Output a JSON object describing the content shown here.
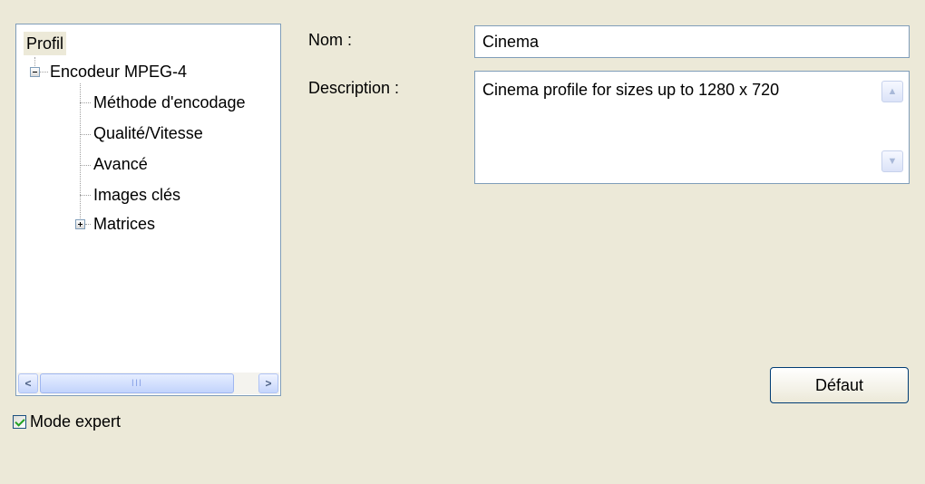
{
  "tree": {
    "root_label": "Profil",
    "nodes": [
      {
        "label": "Encodeur MPEG-4",
        "expander": "minus"
      },
      {
        "label": "Méthode d'encodage"
      },
      {
        "label": "Qualité/Vitesse"
      },
      {
        "label": "Avancé"
      },
      {
        "label": "Images clés"
      },
      {
        "label": "Matrices",
        "expander": "plus"
      }
    ]
  },
  "scrollbar": {
    "thumb_grip": "III",
    "left_arrow": "<",
    "right_arrow": ">"
  },
  "expert_mode": {
    "label": "Mode expert",
    "checked": true
  },
  "form": {
    "name_label": "Nom :",
    "name_value": "Cinema",
    "description_label": "Description :",
    "description_value": "Cinema profile for sizes up to 1280 x 720",
    "up_arrow": "▲",
    "down_arrow": "▼"
  },
  "buttons": {
    "default_label": "Défaut"
  },
  "colors": {
    "background": "#ece9d8",
    "border": "#7f9db9",
    "check": "#21a121"
  }
}
